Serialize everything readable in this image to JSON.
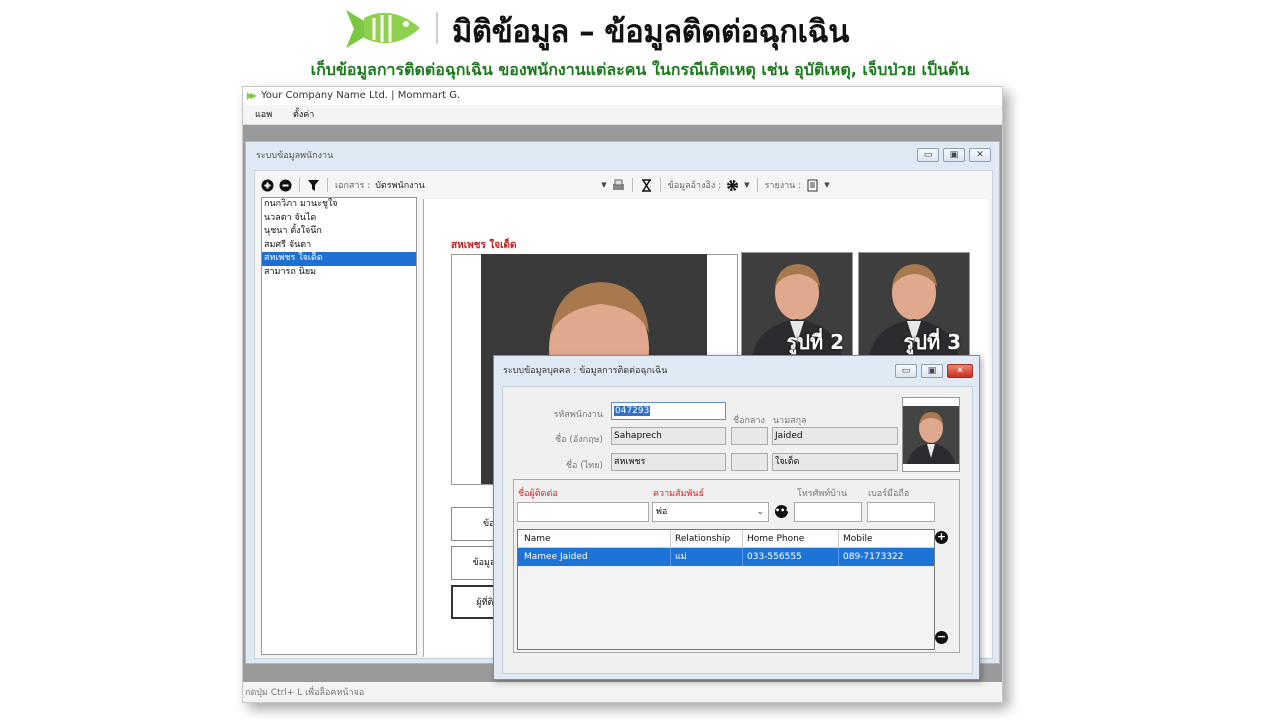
{
  "header": {
    "title": "มิติข้อมูล – ข้อมูลติดต่อฉุกเฉิน",
    "subtitle": "เก็บข้อมูลการติดต่อฉุกเฉิน ของพนักงานแต่ละคน ในกรณีเกิดเหตุ เช่น อุบัติเหตุ, เจ็บป่วย เป็นต้น"
  },
  "app": {
    "title": "Your Company Name Ltd. | Mommart G.",
    "menu": [
      "แอพ",
      "ตั้งค่า"
    ],
    "status": "กดปุ่ม Ctrl+ L เพื่อล็อคหน้าจอ"
  },
  "employee_window": {
    "title": "ระบบข้อมูลพนักงาน",
    "toolbar": {
      "doc_label": "เอกสาร :",
      "doc_value": "บัตรพนักงาน",
      "reference_label": "ข้อมูลอ้างอิง :",
      "report_label": "รายงาน :"
    },
    "employees": [
      "กนกวิภา มานะชูใจ",
      "นวลตา จันได",
      "นุชนา ตั้งใจนึก",
      "สมศรี จันตา",
      "สหเพชร ใจเด็ด",
      "สามารถ นิยม"
    ],
    "selected_employee": "สหเพชร ใจเด็ด",
    "photo_labels": [
      "รูปที่ 2",
      "รูปที่ 3"
    ],
    "side_buttons": [
      "ข้อมูล",
      "ข้อมูลกา",
      "ผู้ที่ติดต่"
    ]
  },
  "dialog": {
    "title": "ระบบข้อมูลบุคคล : ข้อมูลการติดต่อฉุกเฉิน",
    "labels": {
      "employee_code": "รหัสพนักงาน",
      "middle_name": "ชื่อกลาง",
      "last_name": "นามสกุล",
      "name_en": "ชื่อ (อังกฤษ)",
      "name_th": "ชื่อ (ไทย)"
    },
    "values": {
      "employee_code": "047293",
      "first_name_en": "Sahaprech",
      "last_name_en": "Jaided",
      "first_name_th": "สหเพชร",
      "last_name_th": "ใจเด็ด"
    },
    "contact": {
      "name_label": "ชื่อผู้ติดต่อ",
      "relationship_label": "ความสัมพันธ์",
      "home_phone_label": "โทรศัพท์บ้าน",
      "mobile_label": "เบอร์มือถือ",
      "relationship_value": "พ่อ"
    },
    "grid": {
      "columns": [
        "Name",
        "Relationship",
        "Home Phone",
        "Mobile"
      ],
      "rows": [
        {
          "name": "Mamee Jaided",
          "relationship": "แม่",
          "home_phone": "033-556555",
          "mobile": "089-7173322"
        }
      ]
    }
  },
  "colors": {
    "accent_green": "#7ac943",
    "subtitle_green": "#1f7a1f",
    "selection_blue": "#1e6fd1",
    "label_red": "#e02020"
  }
}
